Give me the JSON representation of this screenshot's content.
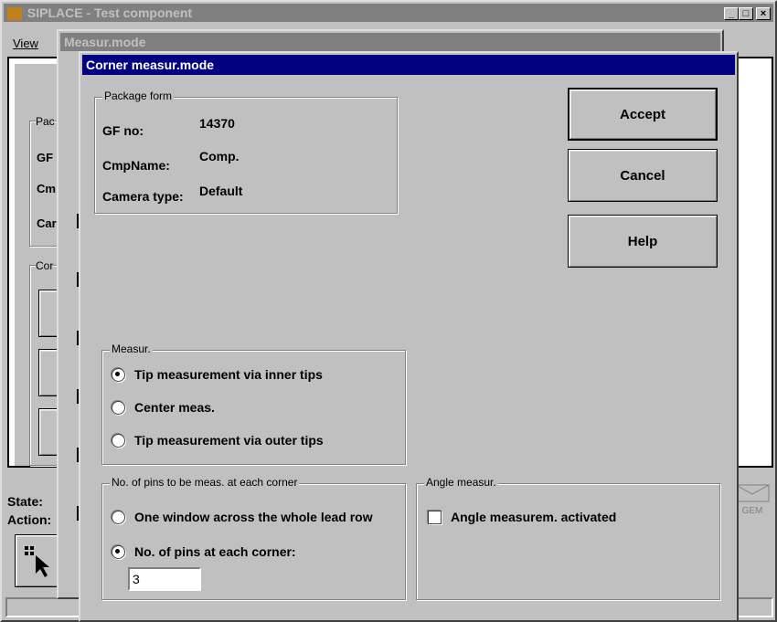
{
  "main_window": {
    "title": "SIPLACE - Test component",
    "menu_view": "View",
    "bg_labels": [
      "Pac",
      "GF",
      "Cm",
      "Car",
      "Cor"
    ],
    "state_label": "State:",
    "action_label": "Action:",
    "gem_label": "GEM"
  },
  "measur_window": {
    "title": "Measur.mode"
  },
  "dialog": {
    "title": "Corner measur.mode",
    "package_form": {
      "legend": "Package form",
      "gf_label": "GF no:",
      "gf_value": "14370",
      "cmp_label": "CmpName:",
      "cmp_value": "Comp.",
      "camera_label": "Camera type:",
      "camera_value": "Default"
    },
    "buttons": {
      "accept": "Accept",
      "cancel": "Cancel",
      "help": "Help"
    },
    "measur": {
      "legend": "Measur.",
      "options": [
        "Tip measurement via inner tips",
        "Center meas.",
        "Tip measurement via outer tips"
      ],
      "selected_index": 0
    },
    "pins": {
      "legend": "No. of pins to be meas. at each corner",
      "options": [
        "One window across the whole lead row",
        "No. of pins at each corner:"
      ],
      "selected_index": 1,
      "pins_value": "3"
    },
    "angle": {
      "legend": "Angle measur.",
      "checkbox_label": "Angle measurem. activated",
      "checked": false
    }
  }
}
